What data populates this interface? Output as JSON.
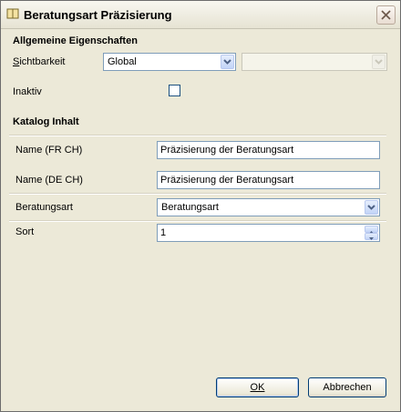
{
  "window": {
    "title": "Beratungsart Präzisierung"
  },
  "general": {
    "heading": "Allgemeine Eigenschaften",
    "visibility_label": "Sichtbarkeit",
    "visibility_value": "Global",
    "inactive_label": "Inaktiv",
    "inactive_checked": false
  },
  "catalog": {
    "heading": "Katalog Inhalt",
    "name_fr_label": "Name (FR CH)",
    "name_fr_value": "Präzisierung der Beratungsart",
    "name_de_label": "Name (DE CH)",
    "name_de_value": "Präzisierung der Beratungsart",
    "beratungsart_label": "Beratungsart",
    "beratungsart_value": "Beratungsart",
    "sort_label": "Sort",
    "sort_value": "1"
  },
  "buttons": {
    "ok": "OK",
    "cancel": "Abbrechen"
  },
  "colors": {
    "accent_border": "#7f9db9",
    "title_bar": "#f8f7f0"
  }
}
